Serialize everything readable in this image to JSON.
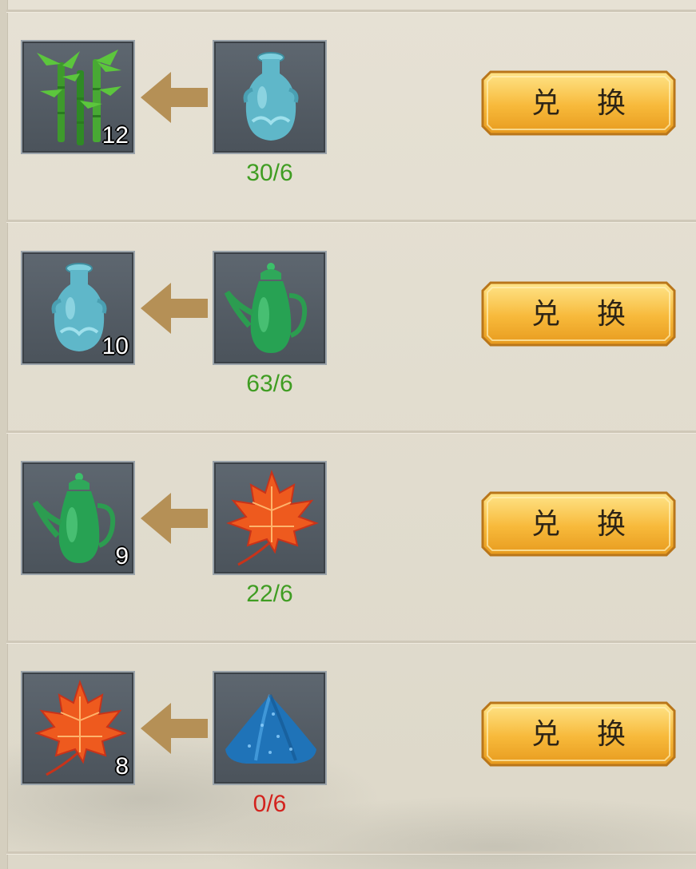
{
  "rows": [
    {
      "reward_item": "bamboo-icon",
      "reward_qty": "12",
      "cost_item": "blue-vase-icon",
      "count": "30/6",
      "count_color": "#3f9d22",
      "button_label": "兑 换"
    },
    {
      "reward_item": "blue-vase-icon",
      "reward_qty": "10",
      "cost_item": "green-teapot-icon",
      "count": "63/6",
      "count_color": "#3f9d22",
      "button_label": "兑 换"
    },
    {
      "reward_item": "green-teapot-icon",
      "reward_qty": "9",
      "cost_item": "maple-leaf-icon",
      "count": "22/6",
      "count_color": "#3f9d22",
      "button_label": "兑 换"
    },
    {
      "reward_item": "maple-leaf-icon",
      "reward_qty": "8",
      "cost_item": "blue-ore-icon",
      "count": "0/6",
      "count_color": "#d3231e",
      "button_label": "兑 换"
    }
  ],
  "colors": {
    "button_gold": "#f3b334",
    "arrow": "#b59056",
    "panel": "#e4dfd1"
  }
}
